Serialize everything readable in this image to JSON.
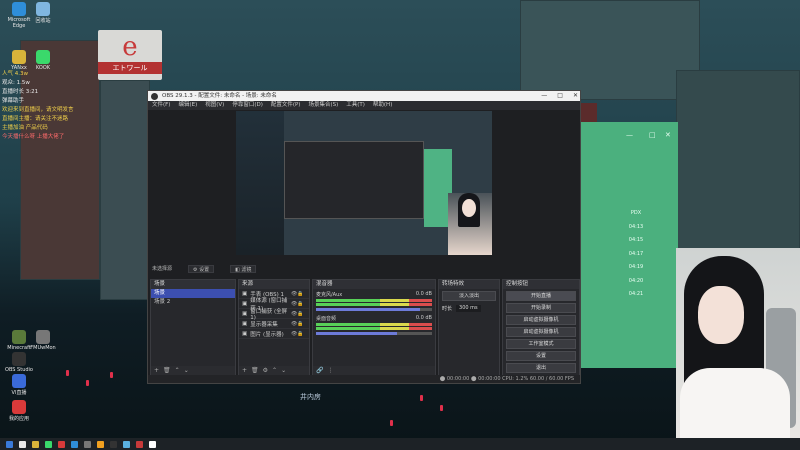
{
  "wallpaper": {
    "sign_char": "e",
    "sign_text": "エトワール",
    "street_sign": "井内房"
  },
  "desktop_icons": [
    {
      "label": "Microsoft Edge",
      "color": "#2f8ed9"
    },
    {
      "label": "回收站",
      "color": "#7fb6e0"
    },
    {
      "label": "YANxx",
      "color": "#d9b33a"
    },
    {
      "label": "KOOK",
      "color": "#3ad96b"
    },
    {
      "label": "Minecraft",
      "color": "#5a7a3a"
    },
    {
      "label": "OBS Studio",
      "color": "#333333"
    },
    {
      "label": "FMUwMon",
      "color": "#777777"
    },
    {
      "label": "VI直播",
      "color": "#3a6ad9"
    },
    {
      "label": "我的应用",
      "color": "#d93a3a"
    }
  ],
  "chat_lines": [
    {
      "text": "人气 4.3w",
      "cls": "y"
    },
    {
      "text": "观众: 1.5w",
      "cls": ""
    },
    {
      "text": "直播时长 3:21",
      "cls": ""
    },
    {
      "text": "弹幕助手",
      "cls": ""
    },
    {
      "text": "",
      "cls": ""
    },
    {
      "text": "",
      "cls": ""
    },
    {
      "text": "",
      "cls": ""
    },
    {
      "text": "",
      "cls": ""
    },
    {
      "text": "",
      "cls": ""
    },
    {
      "text": "欢迎来到直播间，请文明发言",
      "cls": "y"
    },
    {
      "text": "直播间主播：请关注不迷路",
      "cls": "y"
    },
    {
      "text": "主播加油 产品代码",
      "cls": "y"
    },
    {
      "text": "今天播什么呀 上播大佬了",
      "cls": "r"
    },
    {
      "text": "",
      "cls": ""
    },
    {
      "text": "",
      "cls": ""
    },
    {
      "text": "",
      "cls": ""
    },
    {
      "text": "",
      "cls": ""
    },
    {
      "text": "",
      "cls": ""
    },
    {
      "text": "",
      "cls": ""
    },
    {
      "text": "",
      "cls": ""
    },
    {
      "text": "",
      "cls": ""
    },
    {
      "text": "",
      "cls": ""
    },
    {
      "text": "",
      "cls": ""
    },
    {
      "text": "",
      "cls": ""
    }
  ],
  "obs": {
    "title": "OBS 29.1.3 - 配置文件: 未命名 - 场景: 未命名",
    "menu": [
      "文件(F)",
      "编辑(E)",
      "视图(V)",
      "停靠窗口(D)",
      "配置文件(P)",
      "场景集合(S)",
      "工具(T)",
      "帮助(H)"
    ],
    "scene_bar": [
      "未选择源",
      "⚙ 设置",
      "◧ 滤镜"
    ],
    "scenes_header": "场景",
    "scenes": [
      "场景",
      "场景 2"
    ],
    "sources_header": "来源",
    "sources": [
      "手表 (OBS) 1",
      "媒体源 (窗口捕获 1)",
      "窗口捕获 (全屏 1)",
      "显示器采集",
      "图片 (显示器)"
    ],
    "mixer_header": "混音器",
    "mixer": [
      {
        "name": "麦克风/Aux",
        "db": "0.0 dB",
        "level": 0.9
      },
      {
        "name": "桌面音频",
        "db": "0.0 dB",
        "level": 0.7
      }
    ],
    "transitions_header": "转场特效",
    "transition_select": "淡入淡出",
    "duration_label": "时长",
    "duration_value": "300 ms",
    "controls_header": "控制按钮",
    "controls": [
      "开始直播",
      "开始录制",
      "启动虚拟摄像机",
      "启动虚拟摄像机",
      "工作室模式",
      "设置",
      "退出"
    ],
    "status": "⬤ 00:00:00   ⬤ 00:00:00   CPU: 1.2%   60.00 / 60.00 FPS"
  },
  "green_panel": {
    "controls": [
      "—",
      "□",
      "✕"
    ],
    "rows": [
      "PDX",
      "04:13",
      "04:15",
      "04:17",
      "04:19",
      "04:20",
      "04:21"
    ]
  },
  "taskbar_icons": [
    "#3a7ad9",
    "#eaeaea",
    "#d9b33a",
    "#3ad96b",
    "#d93a3a",
    "#2f8ed9",
    "#777777",
    "#f0a020",
    "#333333",
    "#5ab0e0",
    "#c73a3a",
    "#ffffff"
  ]
}
